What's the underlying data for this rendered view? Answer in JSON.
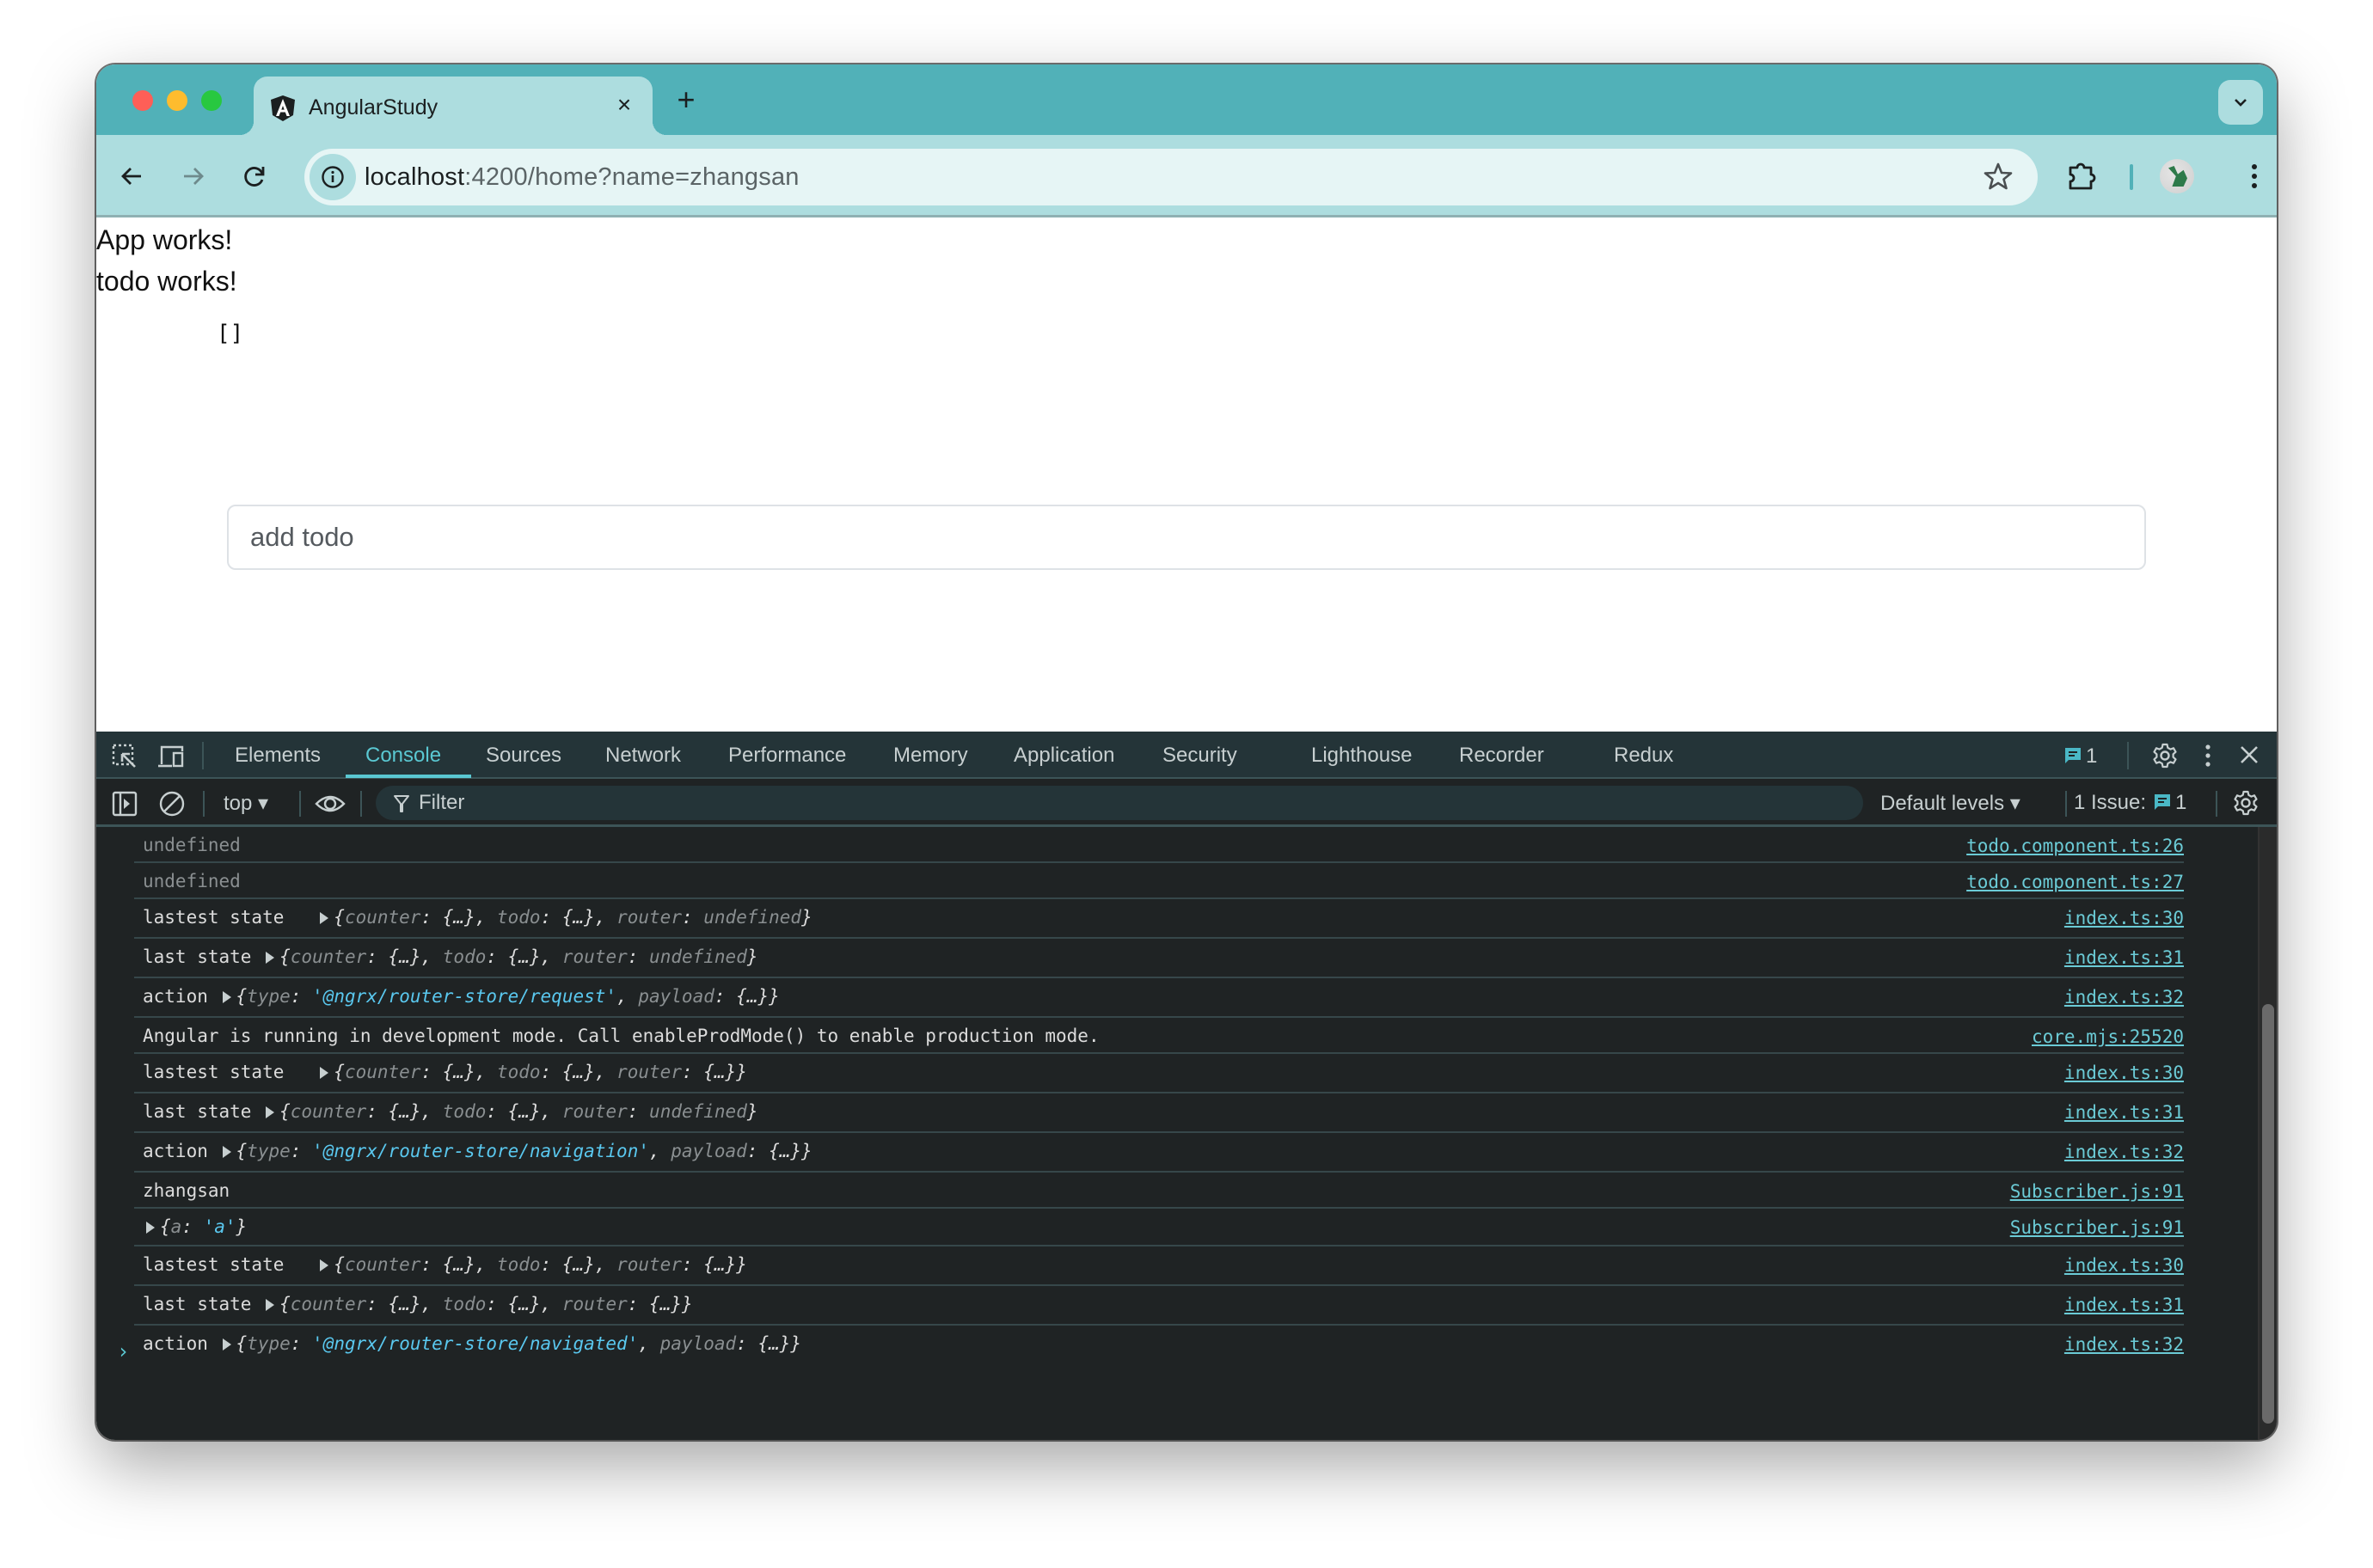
{
  "browser": {
    "tab": {
      "title": "AngularStudy",
      "close": "×"
    },
    "new_tab": "+",
    "address": {
      "host": "localhost",
      "rest": ":4200/home?name=zhangsan"
    }
  },
  "page": {
    "line1": "App works!",
    "line2": "todo works!",
    "todo_list": "[]",
    "input_placeholder": "add todo",
    "input_value": ""
  },
  "devtools": {
    "tabs": [
      "Elements",
      "Console",
      "Sources",
      "Network",
      "Performance",
      "Memory",
      "Application",
      "Security",
      "Lighthouse",
      "Recorder",
      "Redux"
    ],
    "active_tab": "Console",
    "issues_badge": "1",
    "console_toolbar": {
      "context": "top ▾",
      "filter_placeholder": "Filter",
      "levels": "Default levels ▾",
      "issues_label": "1 Issue:",
      "issues_count": "1"
    },
    "console": [
      {
        "kind": "plain-muted",
        "text": "undefined",
        "source": "todo.component.ts:26"
      },
      {
        "kind": "plain-muted",
        "text": "undefined",
        "source": "todo.component.ts:27"
      },
      {
        "kind": "state",
        "label": "lastest state  ",
        "router": "undefined",
        "source": "index.ts:30"
      },
      {
        "kind": "state",
        "label": "last state",
        "router": "undefined",
        "source": "index.ts:31"
      },
      {
        "kind": "action",
        "label": "action",
        "type": "'@ngrx/router-store/request'",
        "source": "index.ts:32"
      },
      {
        "kind": "plain",
        "text": "Angular is running in development mode. Call enableProdMode() to enable production mode.",
        "source": "core.mjs:25520"
      },
      {
        "kind": "state",
        "label": "lastest state  ",
        "router": "{…}",
        "source": "index.ts:30"
      },
      {
        "kind": "state",
        "label": "last state",
        "router": "undefined",
        "source": "index.ts:31"
      },
      {
        "kind": "action",
        "label": "action",
        "type": "'@ngrx/router-store/navigation'",
        "source": "index.ts:32"
      },
      {
        "kind": "plain",
        "text": "zhangsan",
        "source": "Subscriber.js:91"
      },
      {
        "kind": "object",
        "key": "a",
        "value": "'a'",
        "source": "Subscriber.js:91"
      },
      {
        "kind": "state",
        "label": "lastest state  ",
        "router": "{…}",
        "source": "index.ts:30"
      },
      {
        "kind": "state",
        "label": "last state",
        "router": "{…}",
        "source": "index.ts:31"
      },
      {
        "kind": "action",
        "label": "action",
        "type": "'@ngrx/router-store/navigated'",
        "source": "index.ts:32"
      }
    ],
    "prompt": "›"
  },
  "colors": {
    "tabstrip": "#51b1b8",
    "toolbar": "#addddf",
    "devtools_bg": "#1f2324",
    "accent": "#5ac8d2",
    "link": "#6bcbd6"
  }
}
